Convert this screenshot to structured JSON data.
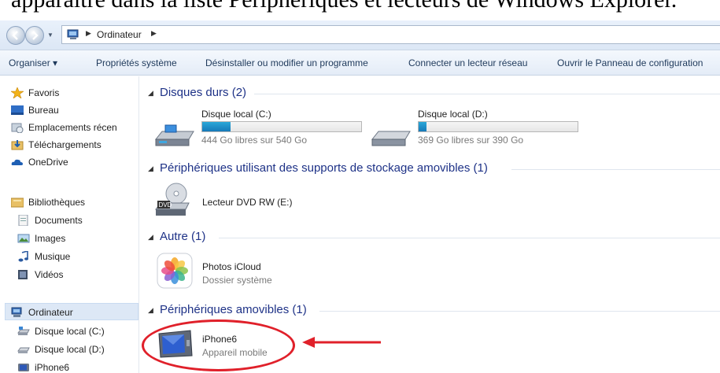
{
  "caption": {
    "text": "apparaître dans la liste Périphériques et lecteurs de Windows Explorer."
  },
  "address": {
    "location": "Ordinateur"
  },
  "commands": [
    {
      "label": "Organiser ▾"
    },
    {
      "label": "Propriétés système"
    },
    {
      "label": "Désinstaller ou modifier un programme"
    },
    {
      "label": "Connecter un lecteur réseau"
    },
    {
      "label": "Ouvrir le Panneau de configuration"
    }
  ],
  "nav": {
    "favoris": "Favoris",
    "bureau": "Bureau",
    "emplacements": "Emplacements récen",
    "telechargements": "Téléchargements",
    "onedrive": "OneDrive",
    "bibliotheques": "Bibliothèques",
    "documents": "Documents",
    "images": "Images",
    "musique": "Musique",
    "videos": "Vidéos",
    "ordinateur": "Ordinateur",
    "disque_c": "Disque local (C:)",
    "disque_d": "Disque local (D:)",
    "iphone": "iPhone6"
  },
  "groups": {
    "disques_durs": "Disques durs (2)",
    "amovibles_stockage": "Périphériques utilisant des supports de stockage amovibles (1)",
    "autre": "Autre (1)",
    "peripheriques_amovibles": "Périphériques amovibles (1)"
  },
  "drives": {
    "c": {
      "name": "Disque local (C:)",
      "free": "444 Go libres sur 540 Go",
      "used_fraction": 0.18
    },
    "d": {
      "name": "Disque local (D:)",
      "free": "369 Go libres sur 390 Go",
      "used_fraction": 0.05
    }
  },
  "dvd": {
    "name": "Lecteur DVD RW (E:)",
    "badge": "DVD"
  },
  "icloud": {
    "name": "Photos iCloud",
    "sub": "Dossier système"
  },
  "iphone": {
    "name": "iPhone6",
    "sub": "Appareil mobile"
  },
  "colors": {
    "accent": "#1e3287",
    "highlight": "#e0202a",
    "bar": "#1779b8"
  }
}
